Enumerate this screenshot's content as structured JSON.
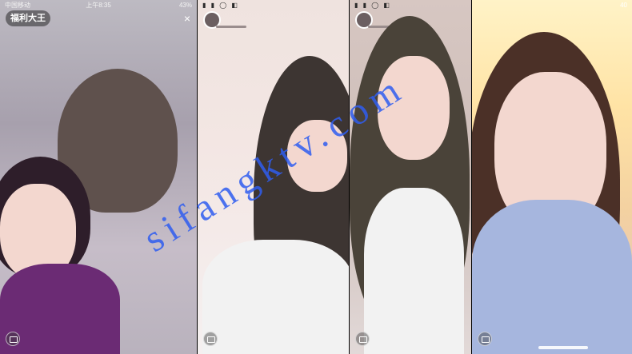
{
  "panel1": {
    "status_carrier": "中国移动",
    "status_time": "上午8:35",
    "status_battery": "43%",
    "badge": "福利大王"
  },
  "panel2": {},
  "panel3": {},
  "panel4": {
    "status_battery": "40"
  },
  "watermark": "sifangktv.com",
  "colors": {
    "watermark": "#2f5df0"
  },
  "icons": [
    "close-icon",
    "chat-icon",
    "avatar"
  ]
}
